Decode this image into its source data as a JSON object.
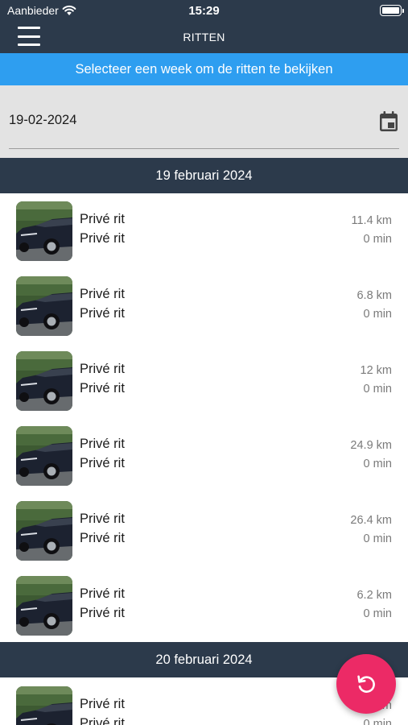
{
  "status": {
    "carrier": "Aanbieder",
    "time": "15:29"
  },
  "nav": {
    "title": "RITTEN",
    "menu_icon": "hamburger-menu-icon"
  },
  "banner": {
    "text": "Selecteer een week om de ritten te bekijken"
  },
  "week_picker": {
    "value": "19-02-2024",
    "icon": "calendar-icon"
  },
  "sections": [
    {
      "date": "19 februari 2024",
      "trips": [
        {
          "title": "Privé rit",
          "subtitle": "Privé rit",
          "distance": "11.4 km",
          "duration": "0 min"
        },
        {
          "title": "Privé rit",
          "subtitle": "Privé rit",
          "distance": "6.8 km",
          "duration": "0 min"
        },
        {
          "title": "Privé rit",
          "subtitle": "Privé rit",
          "distance": "12 km",
          "duration": "0 min"
        },
        {
          "title": "Privé rit",
          "subtitle": "Privé rit",
          "distance": "24.9 km",
          "duration": "0 min"
        },
        {
          "title": "Privé rit",
          "subtitle": "Privé rit",
          "distance": "26.4 km",
          "duration": "0 min"
        },
        {
          "title": "Privé rit",
          "subtitle": "Privé rit",
          "distance": "6.2 km",
          "duration": "0 min"
        }
      ]
    },
    {
      "date": "20 februari 2024",
      "trips": [
        {
          "title": "Privé rit",
          "subtitle": "Privé rit",
          "distance": "km",
          "duration": "0 min"
        }
      ]
    }
  ],
  "fab": {
    "icon": "refresh-icon"
  },
  "colors": {
    "header": "#2c3a4b",
    "banner": "#2e9ef0",
    "fab": "#ec2a66",
    "date_area": "#e3e3e3"
  }
}
